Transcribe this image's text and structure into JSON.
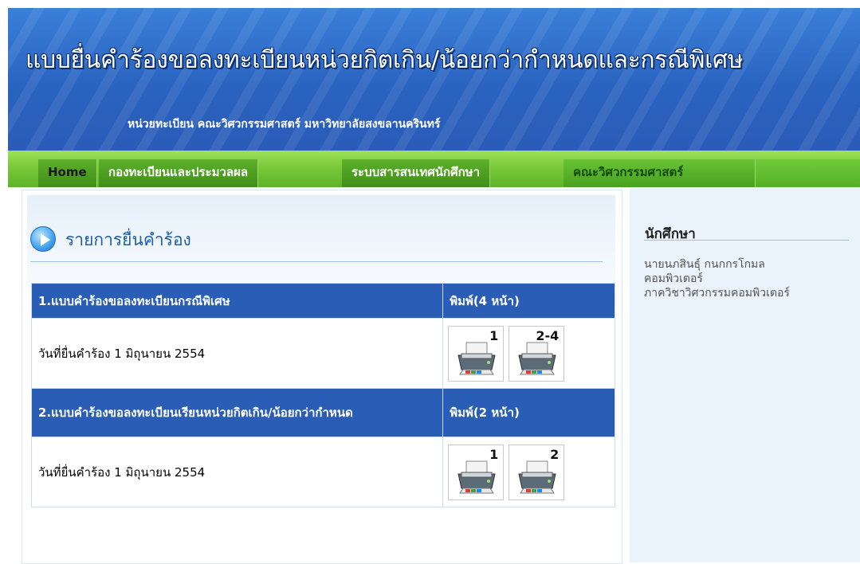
{
  "header": {
    "title": "แบบยื่นคำร้องขอลงทะเบียนหน่วยกิตเกิน/น้อยกว่ากำหนดและกรณีพิเศษ",
    "subtitle": "หน่วยทะเบียน คณะวิศวกรรมศาสตร์ มหาวิทยาลัยสงขลานครินทร์"
  },
  "nav": {
    "items": [
      {
        "label": "Home"
      },
      {
        "label": "กองทะเบียนและประมวลผล"
      },
      {
        "label": "ระบบสารสนเทศนักศึกษา"
      },
      {
        "label": "คณะวิศวกรรมศาสตร์"
      }
    ]
  },
  "main": {
    "section_title": "รายการยื่นคำร้อง",
    "forms": [
      {
        "name": "1.แบบคำร้องขอลงทะเบียนกรณีพิเศษ",
        "print_header": "พิมพ์(4 หน้า)",
        "date": "วันที่ยื่นคำร้อง 1 มิถุนายน 2554",
        "print_buttons": [
          {
            "label": "1",
            "icon": "printer-icon"
          },
          {
            "label": "2-4",
            "icon": "printer-icon"
          }
        ]
      },
      {
        "name": "2.แบบคำร้องขอลงทะเบียนเรียนหน่วยกิตเกิน/น้อยกว่ากำหนด",
        "print_header": "พิมพ์(2 หน้า)",
        "date": "วันที่ยื่นคำร้อง 1 มิถุนายน 2554",
        "print_buttons": [
          {
            "label": "1",
            "icon": "printer-icon"
          },
          {
            "label": "2",
            "icon": "printer-icon"
          }
        ]
      }
    ]
  },
  "sidebar": {
    "title": "นักศึกษา",
    "student_name": "นายนภสินธุ์ กนกกรโกมล",
    "major": "คอมพิวเตอร์",
    "department": "ภาควิชาวิศวกรรมคอมพิวเตอร์"
  },
  "colors": {
    "header_blue": "#2a63c0",
    "nav_green": "#5eb329",
    "table_header": "#2a5db5",
    "sidebar_bg": "#eaf2fb"
  }
}
